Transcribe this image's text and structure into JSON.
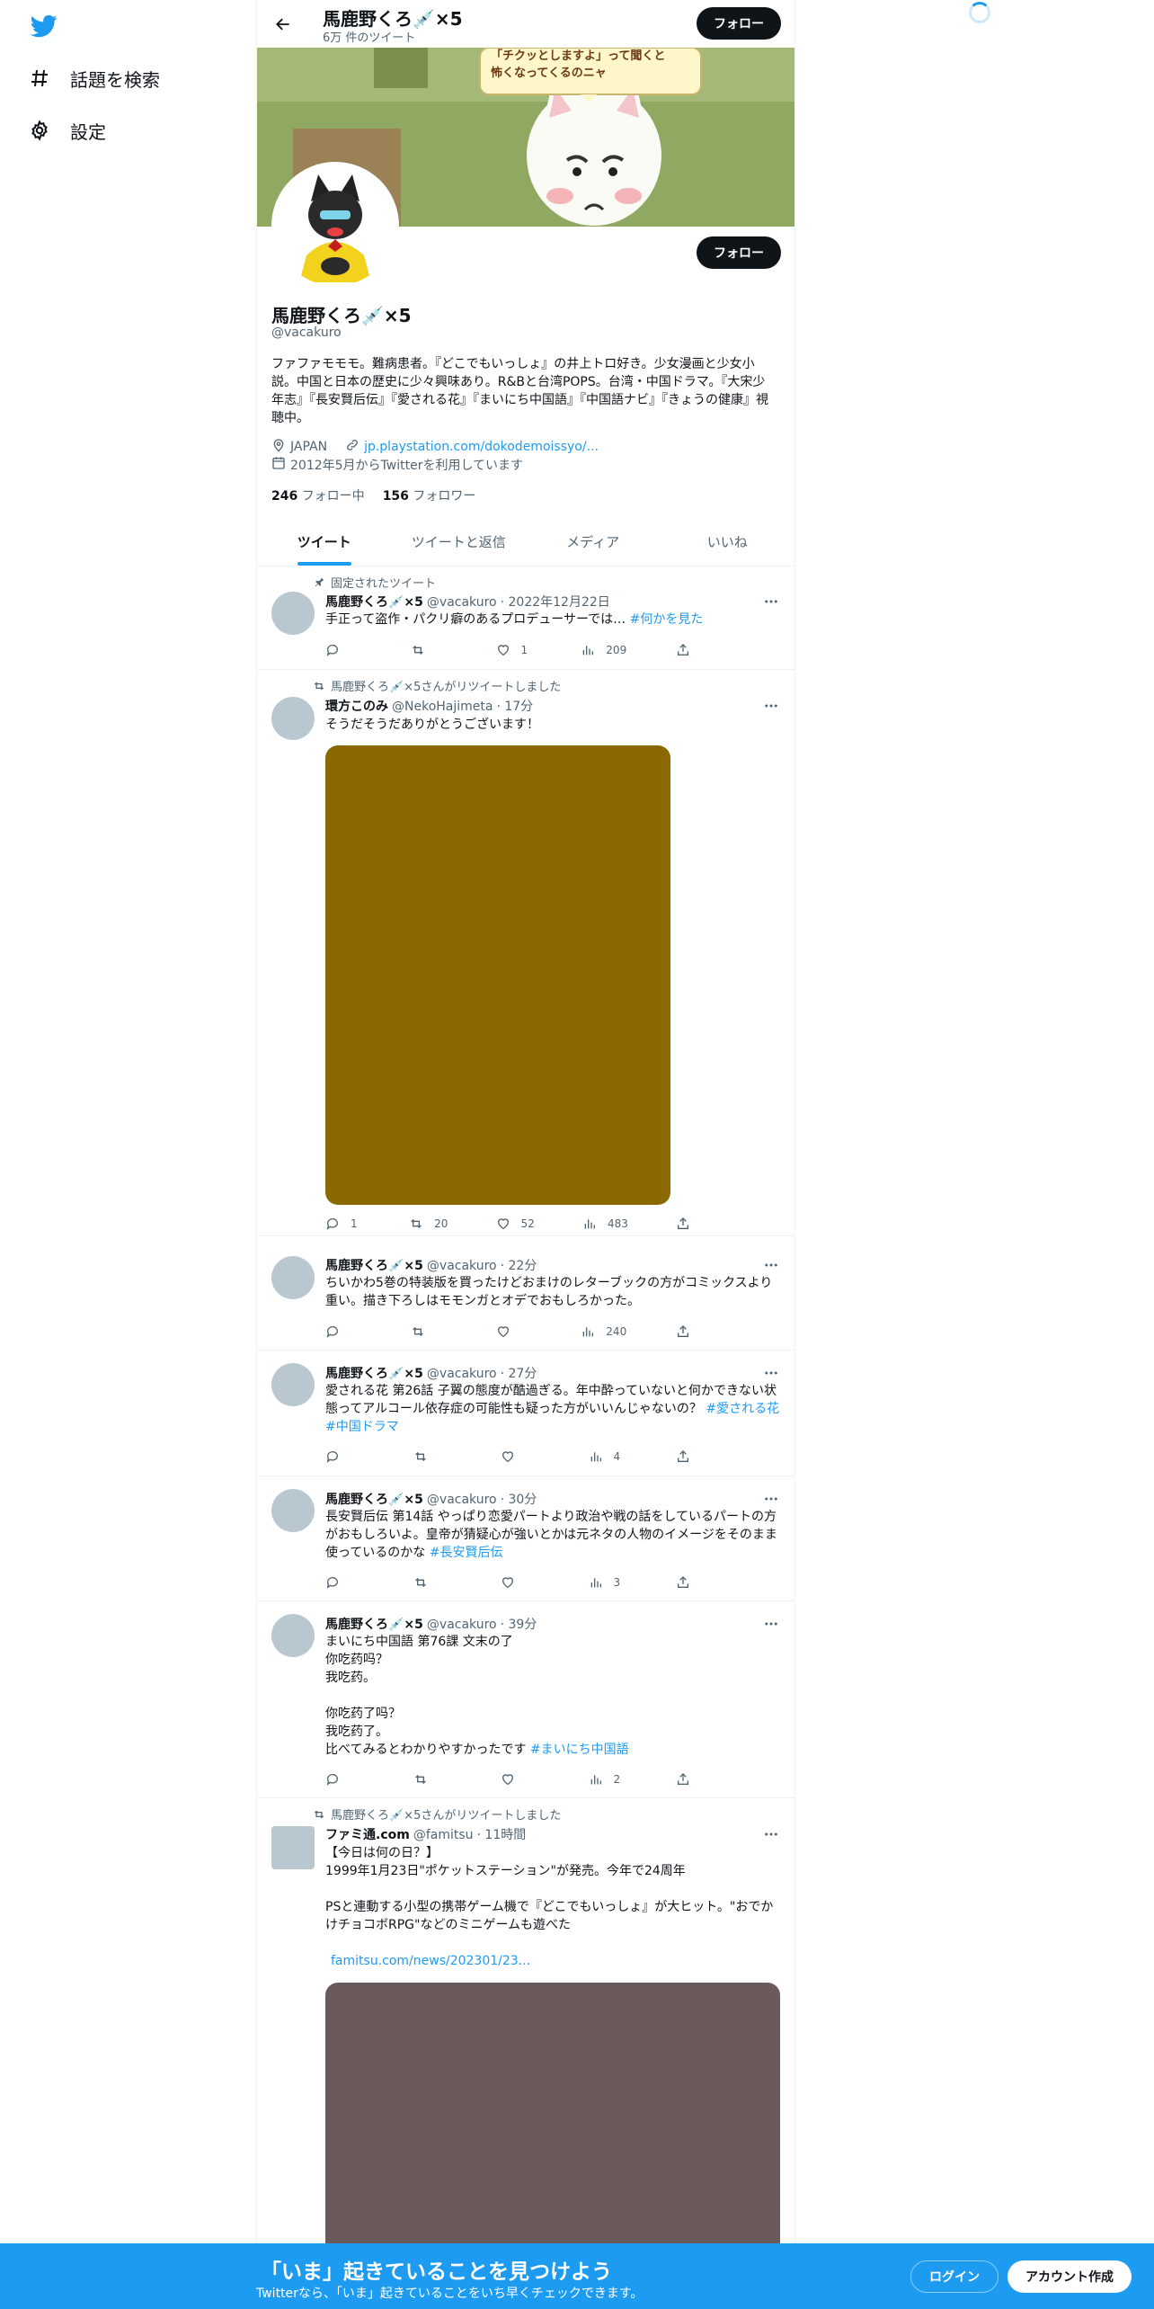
{
  "sidebar": {
    "items": [
      {
        "label": "話題を検索",
        "icon": "hashtag-icon"
      },
      {
        "label": "設定",
        "icon": "gear-icon"
      }
    ]
  },
  "header": {
    "name": "馬鹿野くろ💉×5",
    "tweet_count": "6万 件のツイート",
    "follow_label": "フォロー"
  },
  "banner": {
    "speech": "「チクッとしますよ」って聞くと\n怖くなってくるのニャ"
  },
  "profile": {
    "name": "馬鹿野くろ💉×5",
    "handle": "@vacakuro",
    "follow_label": "フォロー",
    "bio": "ファファモモモ。難病患者。『どこでもいっしょ』の井上トロ好き。少女漫画と少女小説。中国と日本の歴史に少々興味あり。R&Bと台湾POPS。台湾・中国ドラマ。『大宋少年志』『長安賢后伝』『愛される花』『まいにち中国語』『中国語ナビ』『きょうの健康』視聴中。",
    "location": "JAPAN",
    "link": "jp.playstation.com/dokodemoissyo/...",
    "joined": "2012年5月からTwitterを利用しています",
    "following_count": "246",
    "following_label": "フォロー中",
    "followers_count": "156",
    "followers_label": "フォロワー"
  },
  "tabs": [
    {
      "label": "ツイート",
      "active": true
    },
    {
      "label": "ツイートと返信",
      "active": false
    },
    {
      "label": "メディア",
      "active": false
    },
    {
      "label": "いいね",
      "active": false
    }
  ],
  "tweets": [
    {
      "context": "固定されたツイート",
      "name": "馬鹿野くろ💉×5",
      "handle": "@vacakuro",
      "time": "· 2022年12月22日",
      "text": "手正って盗作・パクリ癖のあるプロデューサーでは…",
      "hashtag": "#何かを見た",
      "like": "1",
      "views": "209"
    },
    {
      "context": "馬鹿野くろ💉×5さんがリツイートしました",
      "name": "環方このみ",
      "handle": "@NekoHajimeta",
      "time": "· 17分",
      "text": "そうだそうだありがとうございます！",
      "media_color": "#8a6a00",
      "reply": "1",
      "retweet": "20",
      "like": "52",
      "views": "483"
    },
    {
      "name": "馬鹿野くろ💉×5",
      "handle": "@vacakuro",
      "time": "· 22分",
      "text": "ちいかわ5巻の特装版を買ったけどおまけのレターブックの方がコミックスより重い。描き下ろしはモモンガとオデでおもしろかった。",
      "views": "240"
    },
    {
      "name": "馬鹿野くろ💉×5",
      "handle": "@vacakuro",
      "time": "· 27分",
      "text": "愛される花 第26話 子翼の態度が酷過ぎる。年中酔っていないと何かできない状態ってアルコール依存症の可能性も疑った方がいいんじゃないの？",
      "hashtag": "#愛される花",
      "hashtag2": "#中国ドラマ",
      "views": "4"
    },
    {
      "name": "馬鹿野くろ💉×5",
      "handle": "@vacakuro",
      "time": "· 30分",
      "text": "長安賢后伝 第14話 やっぱり恋愛パートより政治や戦の話をしているパートの方がおもしろいよ。皇帝が猜疑心が強いとかは元ネタの人物のイメージをそのまま使っているのかな",
      "hashtag": "#長安賢后伝",
      "views": "3"
    },
    {
      "name": "馬鹿野くろ💉×5",
      "handle": "@vacakuro",
      "time": "· 39分",
      "text": "まいにち中国語 第76課 文末の了\n你吃药吗？\n我吃药。\n\n你吃药了吗？\n我吃药了。\n比べてみるとわかりやすかったです",
      "hashtag": "#まいにち中国語",
      "views": "2"
    },
    {
      "context": "馬鹿野くろ💉×5さんがリツイートしました",
      "name": "ファミ通.com",
      "handle": "@famitsu",
      "time": "· 11時間",
      "text": "【今日は何の日？】\n1999年1月23日\"ポケットステーション\"が発売。今年で24周年\n\nPSと連動する小型の携帯ゲーム機で『どこでもいっしょ』が大ヒット。\"おでかけチョコボRPG\"などのミニゲームも遊べた",
      "link": "famitsu.com/news/202301/23...",
      "media_color": "#6b5a5c"
    }
  ],
  "bottom_bar": {
    "title": "「いま」起きていることを見つけよう",
    "subtitle": "Twitterなら、「いま」起きていることをいち早くチェックできます。",
    "login": "ログイン",
    "signup": "アカウント作成"
  },
  "colors": {
    "accent": "#1d9bf0",
    "text": "#0f1419",
    "muted": "#536471"
  }
}
